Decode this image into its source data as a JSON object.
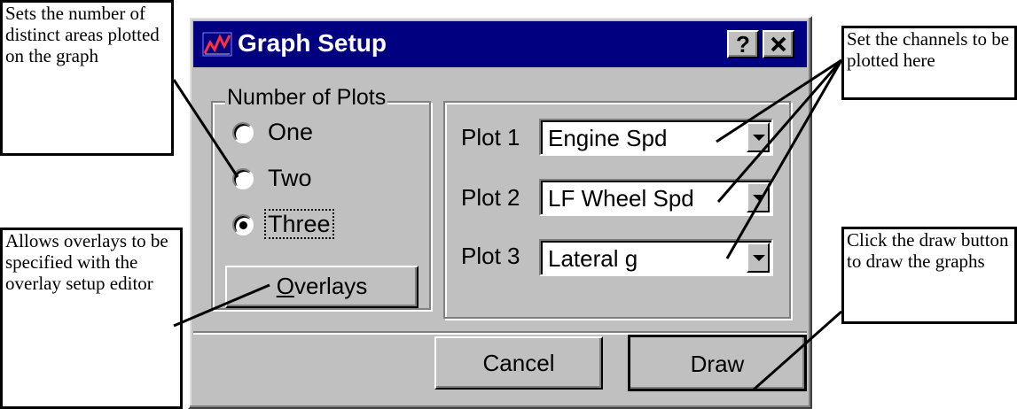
{
  "dialog": {
    "title": "Graph Setup",
    "help_label": "?",
    "close_label": "✕"
  },
  "number_of_plots": {
    "legend": "Number of Plots",
    "options": [
      {
        "label": "One",
        "selected": false
      },
      {
        "label": "Two",
        "selected": false
      },
      {
        "label": "Three",
        "selected": true
      }
    ]
  },
  "overlays_button": {
    "accel": "O",
    "rest": "verlays"
  },
  "plots": [
    {
      "label": "Plot 1",
      "value": "Engine Spd"
    },
    {
      "label": "Plot 2",
      "value": "LF Wheel Spd"
    },
    {
      "label": "Plot 3",
      "value": "Lateral g"
    }
  ],
  "buttons": {
    "cancel": "Cancel",
    "draw": "Draw"
  },
  "callouts": {
    "num_plots": "Sets the number of distinct areas plotted on the graph",
    "overlays": "Allows overlays to be specified with the overlay setup editor",
    "channels": "Set the channels to be plotted here",
    "draw": "Click the draw button to draw the graphs"
  },
  "colors": {
    "titlebar": "#000080",
    "face": "#c0c0c0",
    "callout_border": "#000000"
  }
}
